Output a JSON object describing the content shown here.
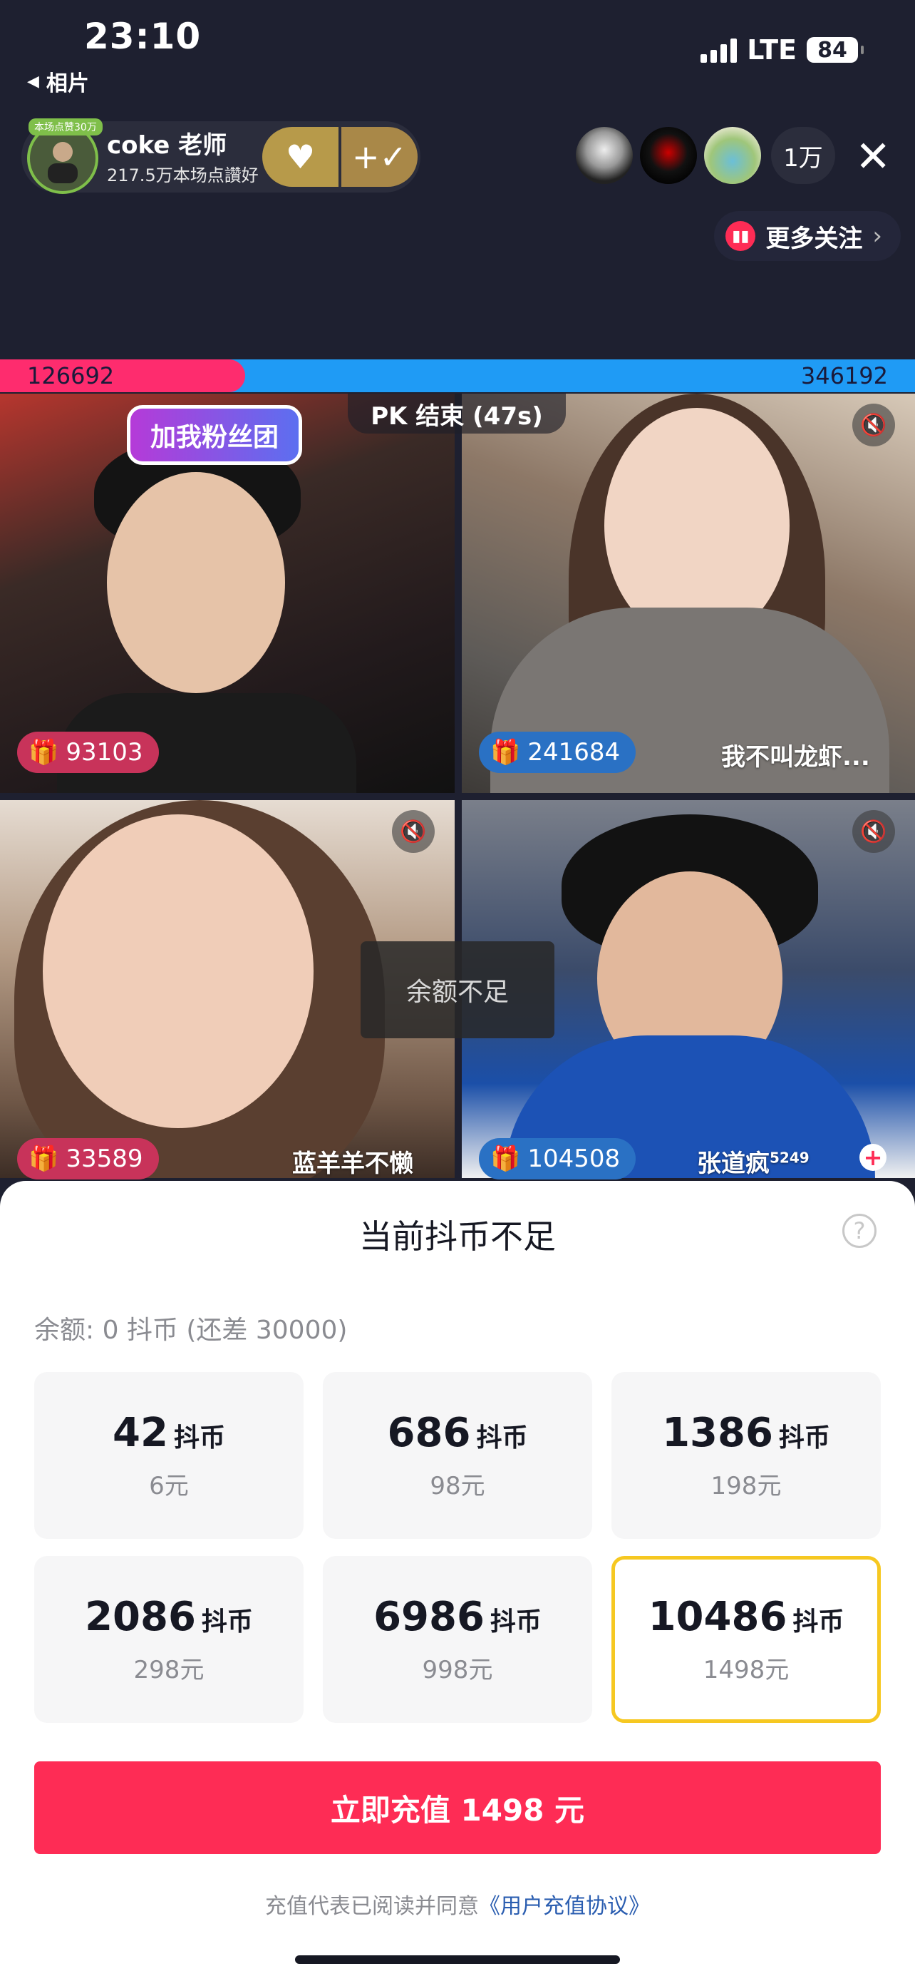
{
  "status_bar": {
    "time": "23:10",
    "back_app": "相片",
    "network": "LTE",
    "battery": "84"
  },
  "host": {
    "badge": "本场点赞30万",
    "name": "coke 老师",
    "likes": "217.5万本场点讚好"
  },
  "viewers": {
    "count": "1万"
  },
  "more_follow": {
    "label": "更多关注"
  },
  "pk": {
    "left_score": "126692",
    "right_score": "346192",
    "left_share": 0.268,
    "result": "PK 结束 (47s)"
  },
  "tiles": [
    {
      "sticker": "加我粉丝团",
      "score": "93103",
      "name": ""
    },
    {
      "score": "241684",
      "name": "我不叫龙虾..."
    },
    {
      "score": "33589",
      "name": "蓝羊羊不懒"
    },
    {
      "score": "104508",
      "name": "张道疯",
      "sup": "5249"
    }
  ],
  "toast": "余额不足",
  "sheet": {
    "title": "当前抖币不足",
    "balance": "余额: 0 抖币 (还差 30000)",
    "unit": "抖币",
    "packages": [
      {
        "coins": "42",
        "price": "6元"
      },
      {
        "coins": "686",
        "price": "98元"
      },
      {
        "coins": "1386",
        "price": "198元"
      },
      {
        "coins": "2086",
        "price": "298元"
      },
      {
        "coins": "6986",
        "price": "998元"
      },
      {
        "coins": "10486",
        "price": "1498元",
        "selected": true
      }
    ],
    "recharge_label": "立即充值 1498 元",
    "agreement_prefix": "充值代表已阅读并同意",
    "agreement_link": "《用户充值协议》"
  },
  "colors": {
    "accent": "#fe2c55",
    "pk_red": "#fe2c6e",
    "pk_blue": "#1f9bf5",
    "selected_border": "#f6c821"
  }
}
